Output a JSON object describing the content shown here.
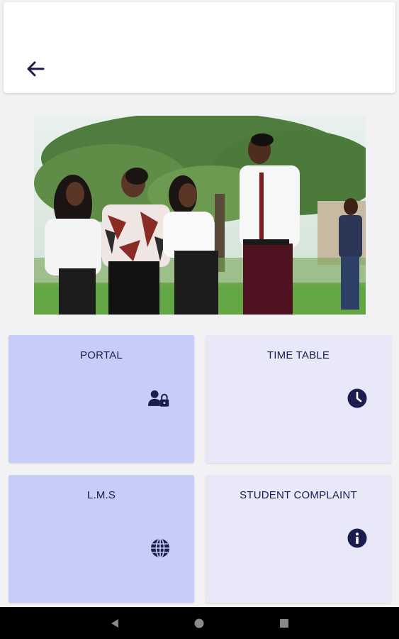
{
  "app_bar": {
    "back_icon": "arrow-left-icon"
  },
  "hero": {
    "image": "students-photo"
  },
  "tiles": [
    {
      "label": "PORTAL",
      "icon": "user-lock-icon",
      "bg": "#c6cdf9"
    },
    {
      "label": "TIME TABLE",
      "icon": "clock-icon",
      "bg": "#e8e8f9"
    },
    {
      "label": "L.M.S",
      "icon": "globe-icon",
      "bg": "#c6cdf9"
    },
    {
      "label": "STUDENT COMPLAINT",
      "icon": "info-icon",
      "bg": "#e8e8f9"
    }
  ],
  "colors": {
    "accent": "#1a1d4d",
    "tile_primary": "#c6cdf9",
    "tile_secondary": "#e8e8f9"
  },
  "system_nav": {
    "back": "nav-back-icon",
    "home": "nav-home-icon",
    "recents": "nav-recents-icon"
  }
}
